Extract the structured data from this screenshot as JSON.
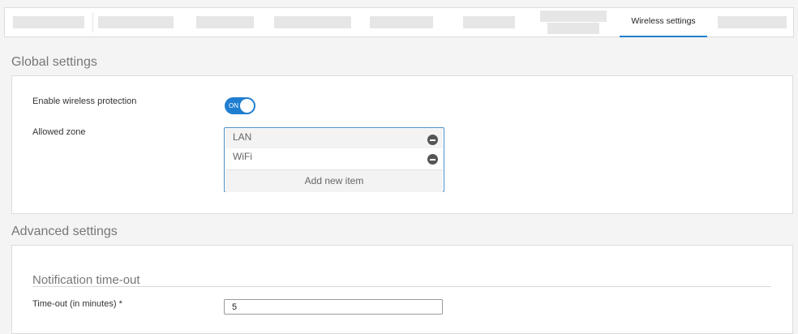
{
  "tabs": {
    "active_label": "Wireless settings"
  },
  "global": {
    "title": "Global settings",
    "enable_label": "Enable wireless protection",
    "toggle_text": "ON",
    "allowed_zone_label": "Allowed zone",
    "zones": [
      "LAN",
      "WiFi"
    ],
    "add_item_label": "Add new item"
  },
  "advanced": {
    "title": "Advanced settings",
    "notification_title": "Notification time-out",
    "timeout_label": "Time-out (in minutes) *",
    "timeout_value": "5"
  },
  "colors": {
    "accent": "#1f7ecf"
  }
}
